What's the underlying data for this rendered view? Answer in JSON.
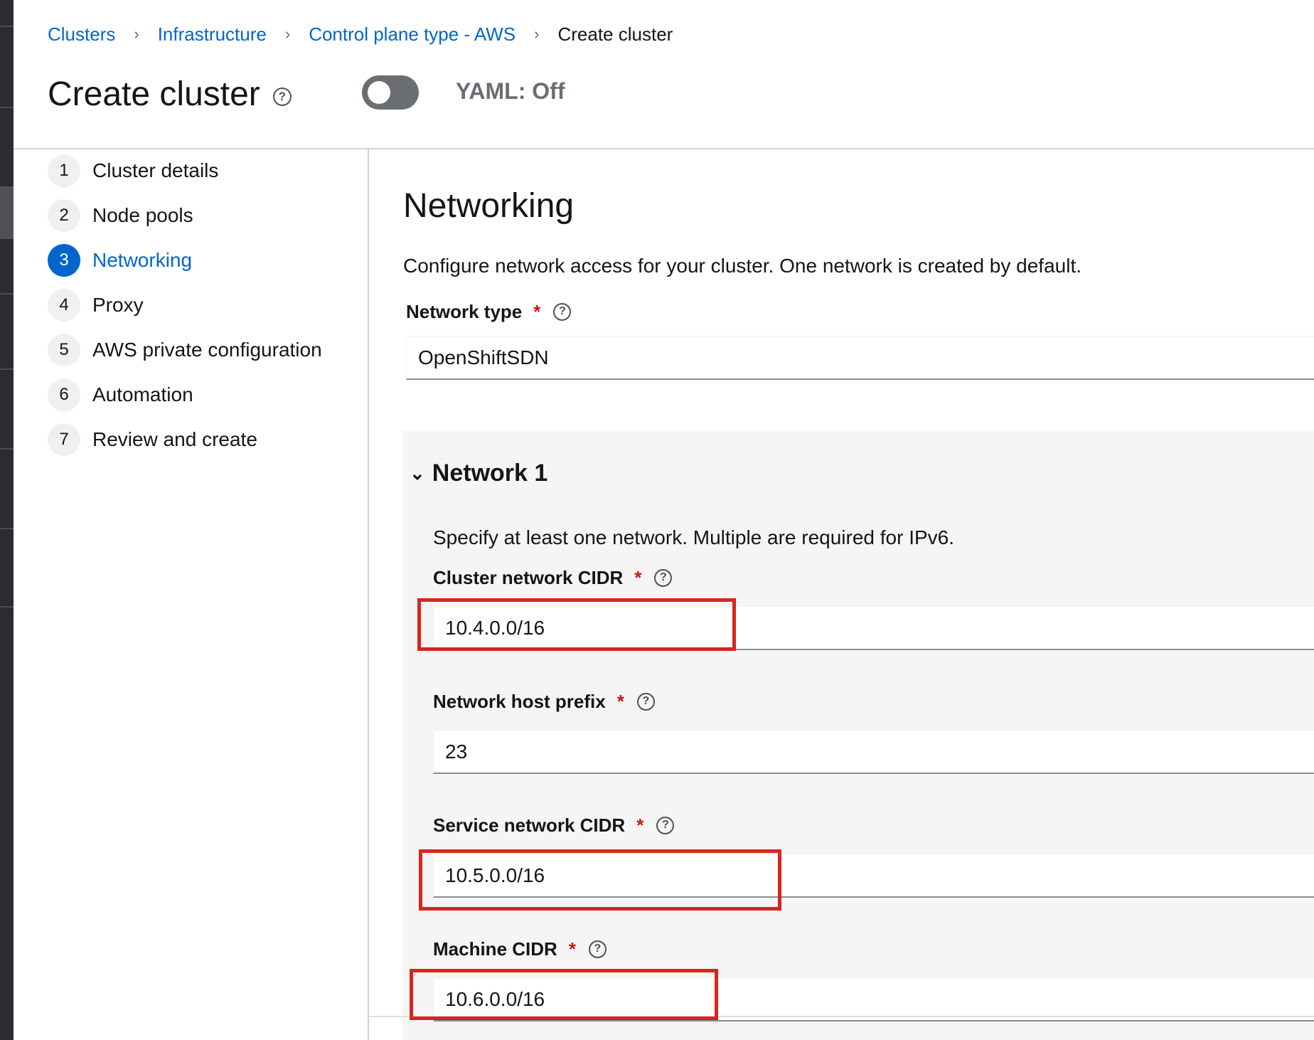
{
  "breadcrumb": {
    "items": [
      "Clusters",
      "Infrastructure",
      "Control plane type - AWS"
    ],
    "current": "Create cluster",
    "separator": "›"
  },
  "header": {
    "title": "Create cluster",
    "help_icon": "help-circle-icon",
    "yaml_toggle": {
      "label": "YAML: Off",
      "on": false
    }
  },
  "wizard": {
    "steps": [
      {
        "num": "1",
        "label": "Cluster details"
      },
      {
        "num": "2",
        "label": "Node pools"
      },
      {
        "num": "3",
        "label": "Networking",
        "current": true
      },
      {
        "num": "4",
        "label": "Proxy"
      },
      {
        "num": "5",
        "label": "AWS private configuration"
      },
      {
        "num": "6",
        "label": "Automation"
      },
      {
        "num": "7",
        "label": "Review and create"
      }
    ]
  },
  "main": {
    "title": "Networking",
    "description": "Configure network access for your cluster. One network is created by default.",
    "network_type": {
      "label": "Network type",
      "required": "*",
      "value": "OpenShiftSDN"
    },
    "network1": {
      "title": "Network 1",
      "chevron": "chevron-down-icon",
      "description": "Specify at least one network. Multiple are required for IPv6.",
      "cluster_cidr": {
        "label": "Cluster network CIDR",
        "required": "*",
        "value": "10.4.0.0/16"
      },
      "host_prefix": {
        "label": "Network host prefix",
        "required": "*",
        "value": "23"
      },
      "service_cidr": {
        "label": "Service network CIDR",
        "required": "*",
        "value": "10.5.0.0/16"
      },
      "machine_cidr": {
        "label": "Machine CIDR",
        "required": "*",
        "value": "10.6.0.0/16"
      }
    }
  },
  "colors": {
    "link": "#0066cc",
    "required": "#c9190b",
    "highlight": "#d9251d",
    "panel_bg": "#f5f5f5"
  }
}
